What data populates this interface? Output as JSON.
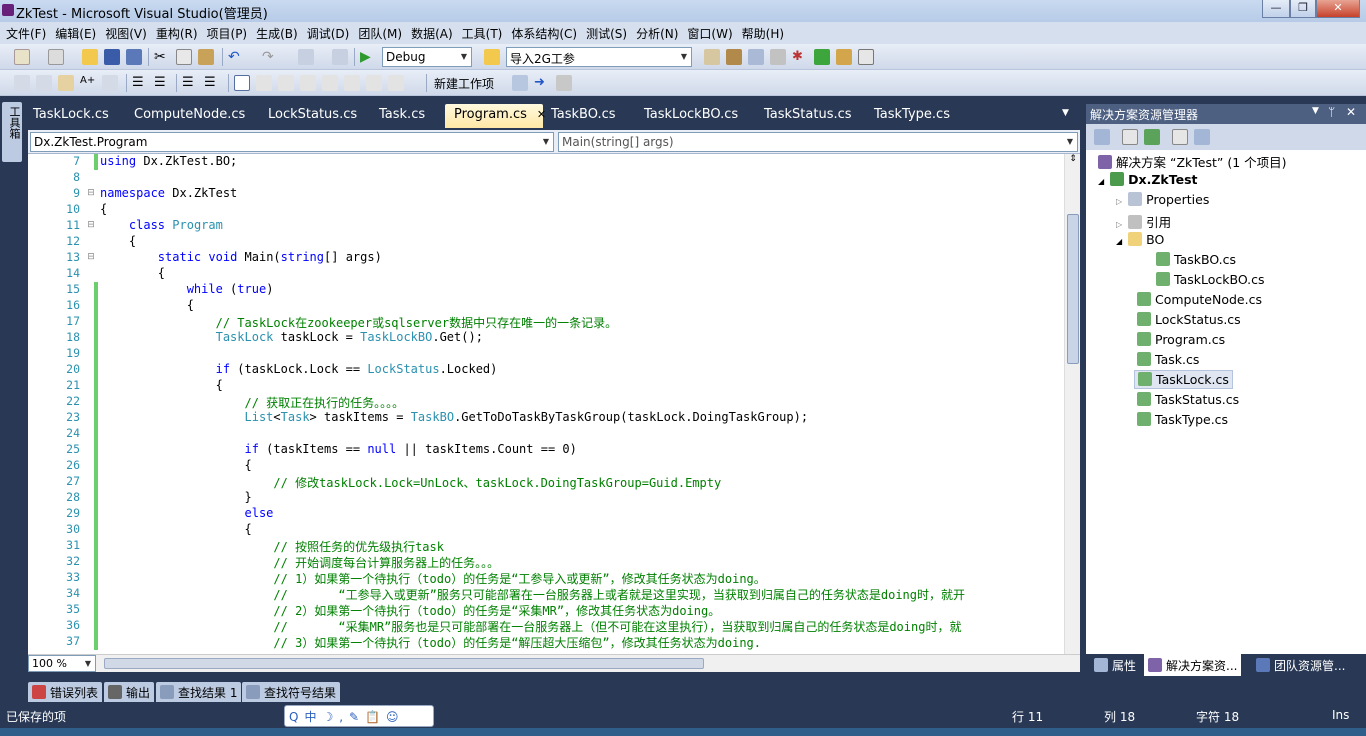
{
  "window": {
    "title": "ZkTest - Microsoft Visual Studio(管理员)"
  },
  "menu": [
    "文件(F)",
    "编辑(E)",
    "视图(V)",
    "重构(R)",
    "项目(P)",
    "生成(B)",
    "调试(D)",
    "团队(M)",
    "数据(A)",
    "工具(T)",
    "体系结构(C)",
    "测试(S)",
    "分析(N)",
    "窗口(W)",
    "帮助(H)"
  ],
  "toolbar": {
    "config_value": "Debug",
    "find_value": "导入2G工参",
    "new_workitem_label": "新建工作项"
  },
  "side_strip": {
    "toolbox_label": "工具箱"
  },
  "doc_tabs": [
    "TaskLock.cs",
    "ComputeNode.cs",
    "LockStatus.cs",
    "Task.cs",
    "Program.cs",
    "TaskBO.cs",
    "TaskLockBO.cs",
    "TaskStatus.cs",
    "TaskType.cs"
  ],
  "active_tab": "Program.cs",
  "nav": {
    "class_combo": "Dx.ZkTest.Program",
    "member_combo": "Main(string[] args)"
  },
  "code_lines": [
    {
      "n": "7",
      "html": "<span class=\"kw\">using</span> Dx.ZkTest.BO;"
    },
    {
      "n": "8",
      "html": ""
    },
    {
      "n": "9",
      "html": "<span class=\"kw\">namespace</span> Dx.ZkTest"
    },
    {
      "n": "10",
      "html": "{"
    },
    {
      "n": "11",
      "html": "    <span class=\"kw\">class</span> <span class=\"ty\">Program</span>"
    },
    {
      "n": "12",
      "html": "    {"
    },
    {
      "n": "13",
      "html": "        <span class=\"kw\">static</span> <span class=\"kw\">void</span> Main(<span class=\"kw\">string</span>[] args)"
    },
    {
      "n": "14",
      "html": "        {"
    },
    {
      "n": "15",
      "html": "            <span class=\"kw\">while</span> (<span class=\"kw\">true</span>)"
    },
    {
      "n": "16",
      "html": "            {"
    },
    {
      "n": "17",
      "html": "                <span class=\"cm\">// TaskLock在zookeeper或sqlserver数据中只存在唯一的一条记录。</span>"
    },
    {
      "n": "18",
      "html": "                <span class=\"ty\">TaskLock</span> taskLock = <span class=\"ty\">TaskLockBO</span>.Get();"
    },
    {
      "n": "19",
      "html": ""
    },
    {
      "n": "20",
      "html": "                <span class=\"kw\">if</span> (taskLock.Lock == <span class=\"ty\">LockStatus</span>.Locked)"
    },
    {
      "n": "21",
      "html": "                {"
    },
    {
      "n": "22",
      "html": "                    <span class=\"cm\">// 获取正在执行的任务。。。。</span>"
    },
    {
      "n": "23",
      "html": "                    <span class=\"ty\">List</span>&lt;<span class=\"ty\">Task</span>&gt; taskItems = <span class=\"ty\">TaskBO</span>.GetToDoTaskByTaskGroup(taskLock.DoingTaskGroup);"
    },
    {
      "n": "24",
      "html": ""
    },
    {
      "n": "25",
      "html": "                    <span class=\"kw\">if</span> (taskItems == <span class=\"kw\">null</span> || taskItems.Count == 0)"
    },
    {
      "n": "26",
      "html": "                    {"
    },
    {
      "n": "27",
      "html": "                        <span class=\"cm\">// 修改taskLock.Lock=UnLock、taskLock.DoingTaskGroup=Guid.Empty</span>"
    },
    {
      "n": "28",
      "html": "                    }"
    },
    {
      "n": "29",
      "html": "                    <span class=\"kw\">else</span>"
    },
    {
      "n": "30",
      "html": "                    {"
    },
    {
      "n": "31",
      "html": "                        <span class=\"cm\">// 按照任务的优先级执行task</span>"
    },
    {
      "n": "32",
      "html": "                        <span class=\"cm\">// 开始调度每台计算服务器上的任务。。。</span>"
    },
    {
      "n": "33",
      "html": "                        <span class=\"cm\">// 1）如果第一个待执行（todo）的任务是“工参导入或更新”，修改其任务状态为doing。</span>"
    },
    {
      "n": "34",
      "html": "                        <span class=\"cm\">//       “工参导入或更新”服务只可能部署在一台服务器上或者就是这里实现，当获取到归属自己的任务状态是doing时，就开</span>"
    },
    {
      "n": "35",
      "html": "                        <span class=\"cm\">// 2）如果第一个待执行（todo）的任务是“采集MR”，修改其任务状态为doing。</span>"
    },
    {
      "n": "36",
      "html": "                        <span class=\"cm\">//       “采集MR”服务也是只可能部署在一台服务器上（但不可能在这里执行），当获取到归属自己的任务状态是doing时，就</span>"
    },
    {
      "n": "37",
      "html": "                        <span class=\"cm\">// 3）如果第一个待执行（todo）的任务是“解压超大压缩包”，修改其任务状态为doing.</span>"
    }
  ],
  "zoom": "100 %",
  "solution_explorer": {
    "title": "解决方案资源管理器",
    "solution": "解决方案 “ZkTest” (1 个项目)",
    "project": "Dx.ZkTest",
    "items": {
      "properties": "Properties",
      "references": "引用",
      "bo_folder": "BO",
      "bo_files": [
        "TaskBO.cs",
        "TaskLockBO.cs"
      ],
      "files": [
        "ComputeNode.cs",
        "LockStatus.cs",
        "Program.cs",
        "Task.cs",
        "TaskLock.cs",
        "TaskStatus.cs",
        "TaskType.cs"
      ]
    },
    "selected": "TaskLock.cs"
  },
  "right_tabs": [
    "属性",
    "解决方案资...",
    "团队资源管..."
  ],
  "bottom_tabs": [
    "错误列表",
    "输出",
    "查找结果 1",
    "查找符号结果"
  ],
  "status": {
    "message": "已保存的项",
    "line": "行 11",
    "col": "列 18",
    "char": "字符 18",
    "mode": "Ins"
  },
  "colors": {
    "chrome_dark": "#293955",
    "tab_active": "#ffe8a6",
    "keyword": "#0000ff",
    "type": "#2b91af",
    "comment": "#008000"
  }
}
